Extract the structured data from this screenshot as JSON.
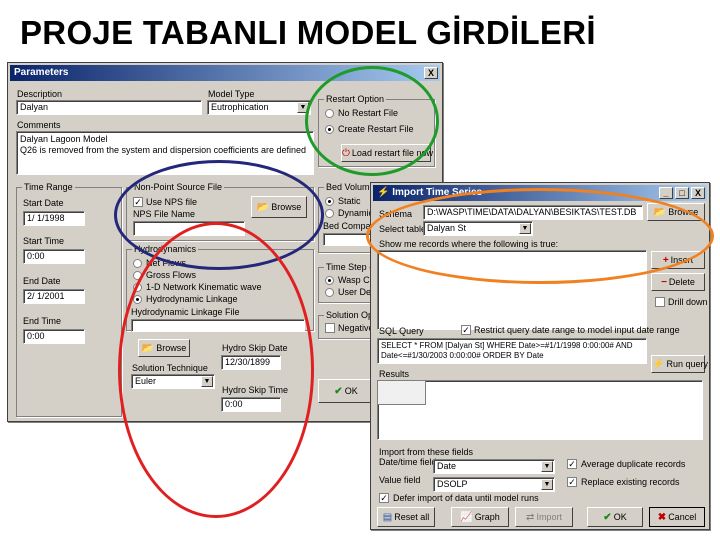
{
  "slide": {
    "title": "PROJE TABANLI MODEL GİRDİLERİ"
  },
  "parameters": {
    "title": "Parameters",
    "close": "X",
    "description": {
      "label": "Description",
      "value": "Dalyan"
    },
    "model_type": {
      "label": "Model Type",
      "value": "Eutrophication"
    },
    "comments": {
      "label": "Comments",
      "line1": "Dalyan Lagoon Model",
      "line2": "Q26 is removed from the system and dispersion coefficients are defined"
    },
    "restart": {
      "title": "Restart Option",
      "no_restart": "No Restart File",
      "create_restart": "Create Restart File",
      "load_button": "Load restart file now"
    },
    "time_range": {
      "title": "Time Range",
      "start_date_label": "Start Date",
      "start_date": "1/ 1/1998",
      "start_time_label": "Start Time",
      "start_time": "0:00",
      "end_date_label": "End Date",
      "end_date": "2/ 1/2001",
      "end_time_label": "End Time",
      "end_time": "0:00"
    },
    "nps": {
      "title": "Non-Point Source File",
      "use_label": "Use NPS file",
      "file_label": "NPS File Name",
      "browse": "Browse"
    },
    "hydro": {
      "title": "Hydrodynamics",
      "net_flows": "Net Flows",
      "gross_flows": "Gross Flows",
      "network": "1-D Network Kinematic wave",
      "hydro_linkage": "Hydrodynamic Linkage",
      "file_label": "Hydrodynamic Linkage File",
      "browse": "Browse"
    },
    "solution": {
      "label": "Solution Technique",
      "value": "Euler"
    },
    "skip": {
      "date_label": "Hydro Skip Date",
      "date": "12/30/1899",
      "time_label": "Hydro Skip Time",
      "time": "0:00"
    },
    "bed": {
      "title": "Bed Volumes",
      "static": "Static",
      "dynamic": "Dynamic",
      "compaction": "Bed Compaction"
    },
    "time_step": {
      "title": "Time Step",
      "wasp": "Wasp Calculated",
      "user": "User Defined"
    },
    "sol_opt": {
      "title": "Solution Options",
      "negative": "Negative Solution"
    },
    "ok": "OK"
  },
  "import": {
    "title": "Import Time Series",
    "schema_label": "Schema",
    "schema_value": "D:\\WASP\\TIME\\DATA\\DALYAN\\BESIKTAS\\TEST.DB",
    "browse": "Browse",
    "table_label": "Select table",
    "table_value": "Dalyan St",
    "where_label": "Show me records where the following is true:",
    "insert": "Insert",
    "delete": "Delete",
    "drill": "Drill down",
    "sql_label": "SQL Query",
    "restrict_label": "Restrict query date range to model input date range",
    "sql_line1": "SELECT * FROM [Dalyan St] WHERE Date>=#1/1/1998 0:00:00# AND",
    "sql_line2": "Date<=#1/30/2003 0:00:00# ORDER BY Date",
    "run_query": "Run query",
    "results_label": "Results",
    "fields_label": "Import from these fields",
    "datetime_label": "Date/time field",
    "datetime_value": "Date",
    "value_label": "Value field",
    "value_value": "DSOLP",
    "avg_label": "Average duplicate records",
    "replace_label": "Replace existing records",
    "defer_label": "Defer import of data until model runs",
    "reset": "Reset all",
    "graph": "Graph",
    "import_btn": "Import",
    "ok": "OK",
    "cancel": "Cancel",
    "minimize": "_",
    "maximize": "□",
    "close": "X"
  },
  "colors": {
    "green": "#1e9b2a",
    "navy": "#23287a",
    "red": "#e02020",
    "orange": "#f08020",
    "title_bar": "#0a246a"
  },
  "icons": [
    "folder-icon",
    "restart-icon",
    "checkmark-icon",
    "plus-icon",
    "minus-icon",
    "graph-icon",
    "import-icon",
    "cancel-icon",
    "lightning-icon"
  ]
}
